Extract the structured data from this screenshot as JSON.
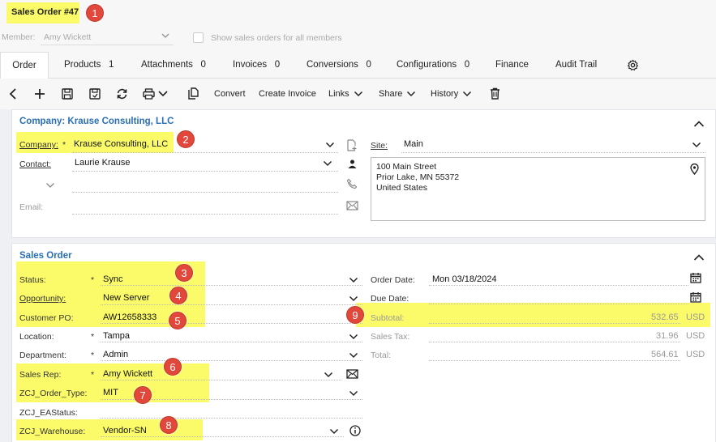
{
  "header": {
    "order_title": "Sales Order #47",
    "member_label": "Member:",
    "member_value": "Amy Wickett",
    "show_all_label": "Show sales orders for all members"
  },
  "tabs": [
    {
      "label": "Order",
      "count": ""
    },
    {
      "label": "Products",
      "count": "1"
    },
    {
      "label": "Attachments",
      "count": "0"
    },
    {
      "label": "Invoices",
      "count": "0"
    },
    {
      "label": "Conversions",
      "count": "0"
    },
    {
      "label": "Configurations",
      "count": "0"
    },
    {
      "label": "Finance",
      "count": ""
    },
    {
      "label": "Audit Trail",
      "count": ""
    }
  ],
  "toolbar": {
    "convert": "Convert",
    "create_invoice": "Create Invoice",
    "links": "Links",
    "share": "Share",
    "history": "History"
  },
  "company_panel": {
    "title": "Company: Krause Consulting, LLC",
    "company_label": "Company:",
    "company_value": "Krause Consulting, LLC",
    "contact_label": "Contact:",
    "contact_value": "Laurie Krause",
    "email_label": "Email:",
    "site_label": "Site:",
    "site_value": "Main",
    "address_lines": [
      "100 Main Street",
      "Prior Lake, MN 55372",
      "United States"
    ]
  },
  "sales_panel": {
    "title": "Sales Order",
    "fields": {
      "status": {
        "label": "Status:",
        "value": "Sync"
      },
      "opportunity": {
        "label": "Opportunity:",
        "value": "New Server"
      },
      "customer_po": {
        "label": "Customer PO:",
        "value": "AW12658333"
      },
      "location": {
        "label": "Location:",
        "value": "Tampa"
      },
      "department": {
        "label": "Department:",
        "value": "Admin"
      },
      "sales_rep": {
        "label": "Sales Rep:",
        "value": "Amy Wickett"
      },
      "order_type": {
        "label": "ZCJ_Order_Type:",
        "value": "MIT"
      },
      "ea_status": {
        "label": "ZCJ_EAStatus:",
        "value": ""
      },
      "warehouse": {
        "label": "ZCJ_Warehouse:",
        "value": "Vendor-SN"
      }
    },
    "order_date": {
      "label": "Order Date:",
      "value": "Mon 03/18/2024"
    },
    "due_date": {
      "label": "Due Date:",
      "value": ""
    },
    "subtotal": {
      "label": "Subtotal:",
      "value": "532.65",
      "currency": "USD"
    },
    "sales_tax": {
      "label": "Sales Tax:",
      "value": "31.96",
      "currency": "USD"
    },
    "total": {
      "label": "Total:",
      "value": "564.61",
      "currency": "USD"
    }
  },
  "required_mark": "*",
  "callouts": [
    "1",
    "2",
    "3",
    "4",
    "5",
    "6",
    "7",
    "8",
    "9"
  ],
  "colors": {
    "highlight": "#fbfb6a",
    "callout": "#e2473b",
    "link": "#2a6fb5"
  }
}
